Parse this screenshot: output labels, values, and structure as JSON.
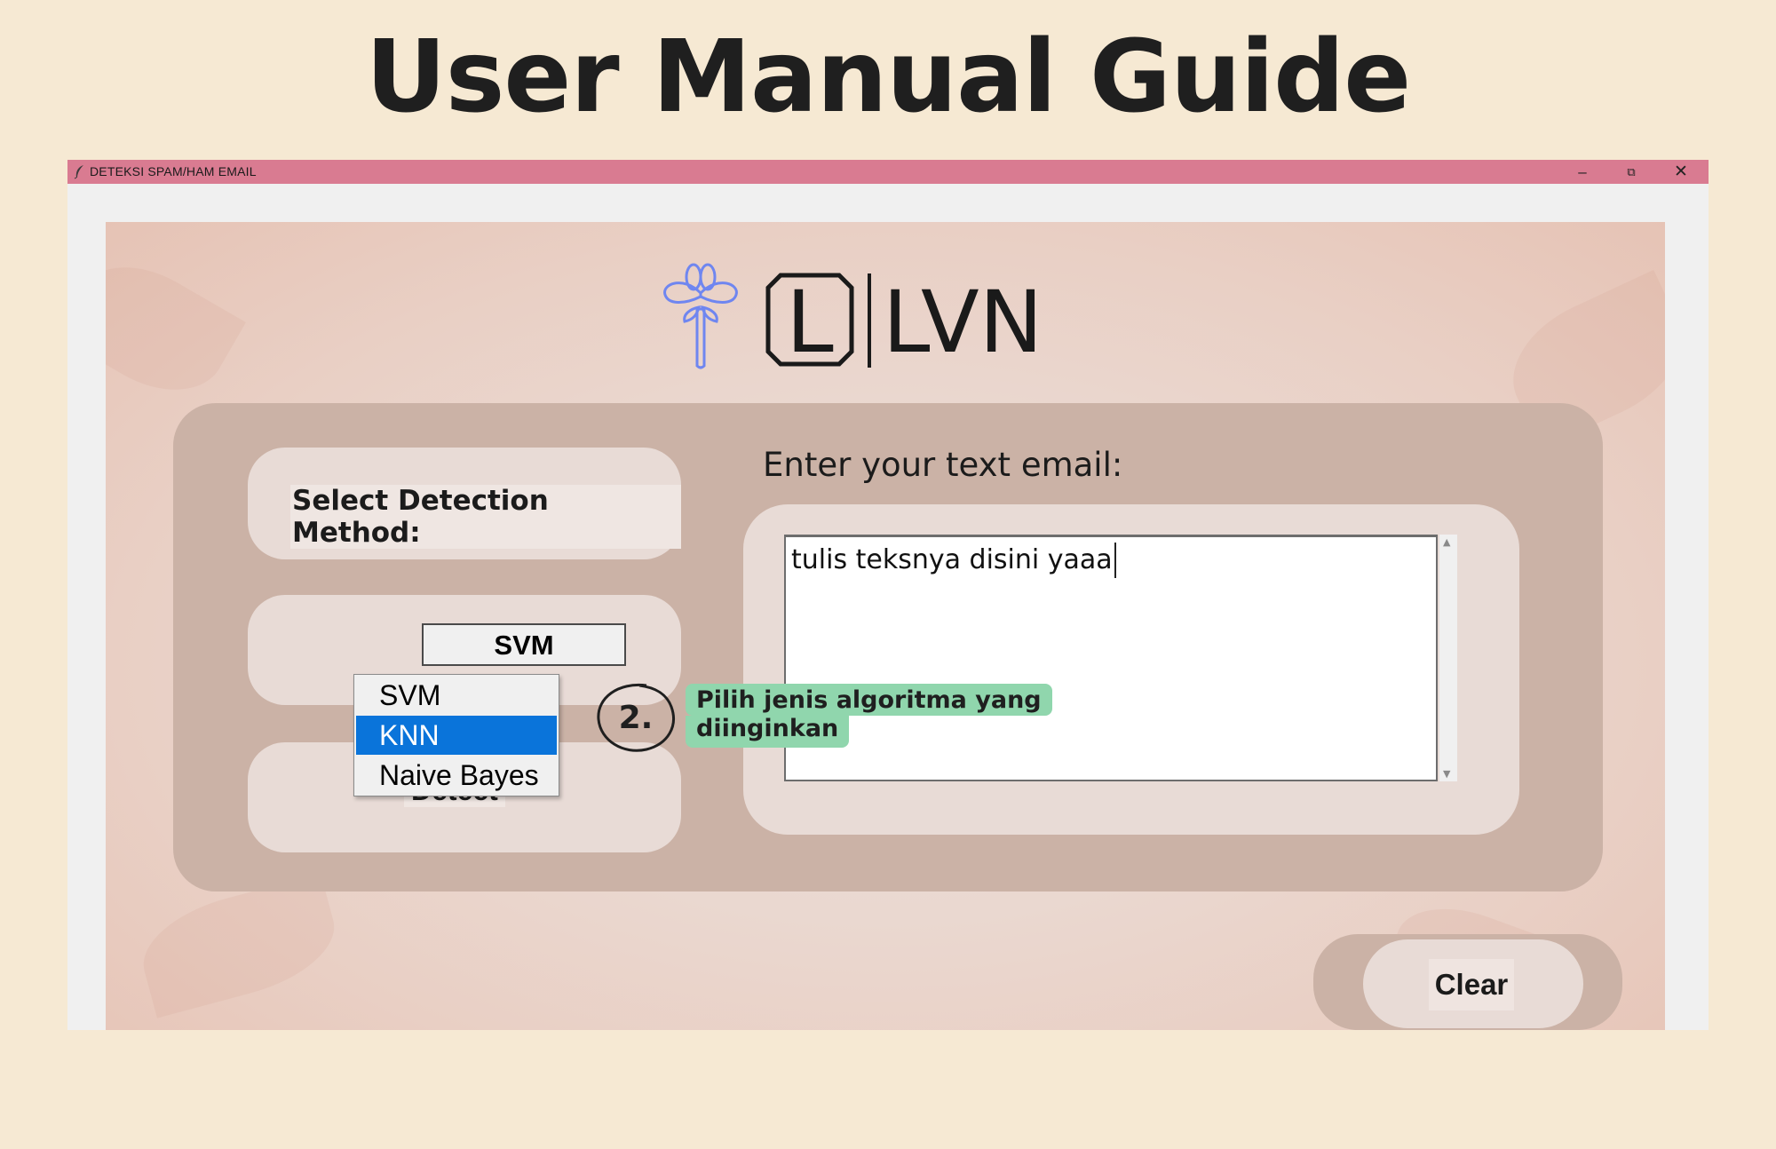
{
  "page": {
    "title": "User Manual Guide"
  },
  "window": {
    "title": "DETEKSI SPAM/HAM EMAIL",
    "controls": {
      "minimize": "–",
      "maximize": "⧉",
      "close": "✕"
    },
    "titlebar_color": "#d97b91"
  },
  "app": {
    "logo_text": "LVN",
    "logo_letter": "L",
    "method_label": "Select Detection Method:",
    "selected_method": "SVM",
    "method_options": [
      "SVM",
      "KNN",
      "Naive Bayes"
    ],
    "highlighted_option": "KNN",
    "detect_button": "Detect",
    "email_label": "Enter your text email:",
    "email_text": "tulis teksnya disini yaaa",
    "clear_button": "Clear",
    "scroll_up": "▲",
    "scroll_down": "▼"
  },
  "annotation": {
    "step": "2.",
    "hint_line1": "Pilih jenis algoritma yang",
    "hint_line2": "diinginkan",
    "hint_color": "#90d6ad"
  }
}
